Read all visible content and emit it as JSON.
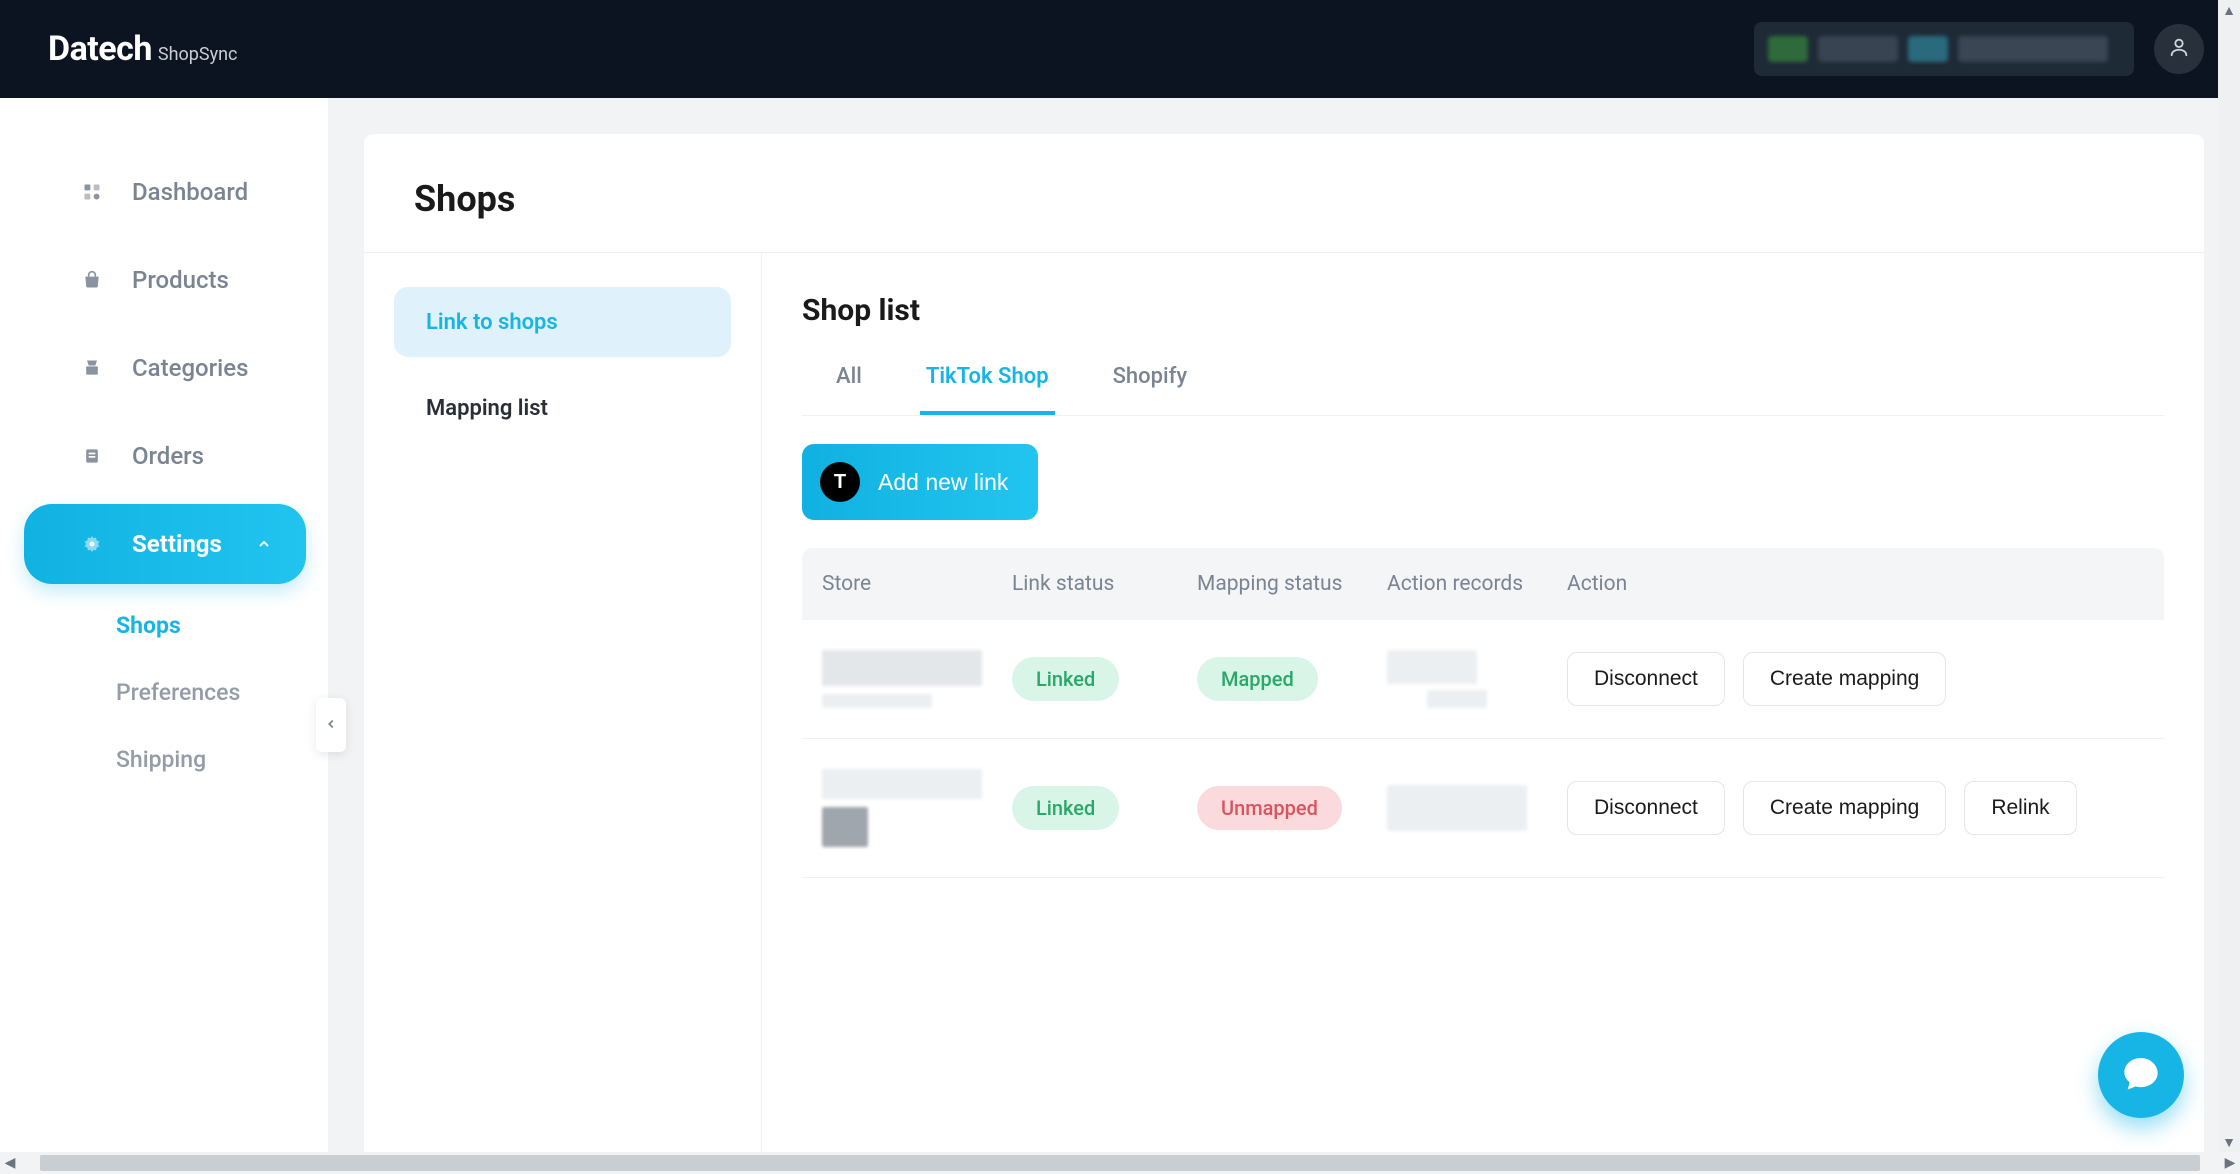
{
  "brand": {
    "main": "Datech",
    "sub": "ShopSync"
  },
  "sidebar": {
    "items": [
      {
        "label": "Dashboard",
        "icon": "dashboard"
      },
      {
        "label": "Products",
        "icon": "products"
      },
      {
        "label": "Categories",
        "icon": "categories"
      },
      {
        "label": "Orders",
        "icon": "orders"
      },
      {
        "label": "Settings",
        "icon": "settings",
        "active": true
      }
    ],
    "settings_children": [
      {
        "label": "Shops",
        "active": true
      },
      {
        "label": "Preferences"
      },
      {
        "label": "Shipping"
      }
    ]
  },
  "page": {
    "title": "Shops",
    "side_tabs": [
      {
        "label": "Link to shops",
        "active": true
      },
      {
        "label": "Mapping list"
      }
    ]
  },
  "shoplist": {
    "title": "Shop list",
    "tabs": [
      {
        "label": "All"
      },
      {
        "label": "TikTok Shop",
        "active": true
      },
      {
        "label": "Shopify"
      }
    ],
    "add_button": {
      "badge": "T",
      "label": "Add new link"
    },
    "columns": [
      "Store",
      "Link status",
      "Mapping status",
      "Action records",
      "Action"
    ],
    "rows": [
      {
        "link_status": "Linked",
        "mapping_status": "Mapped",
        "actions": [
          "Disconnect",
          "Create mapping"
        ]
      },
      {
        "link_status": "Linked",
        "mapping_status": "Unmapped",
        "actions": [
          "Disconnect",
          "Create mapping",
          "Relink"
        ]
      }
    ]
  }
}
